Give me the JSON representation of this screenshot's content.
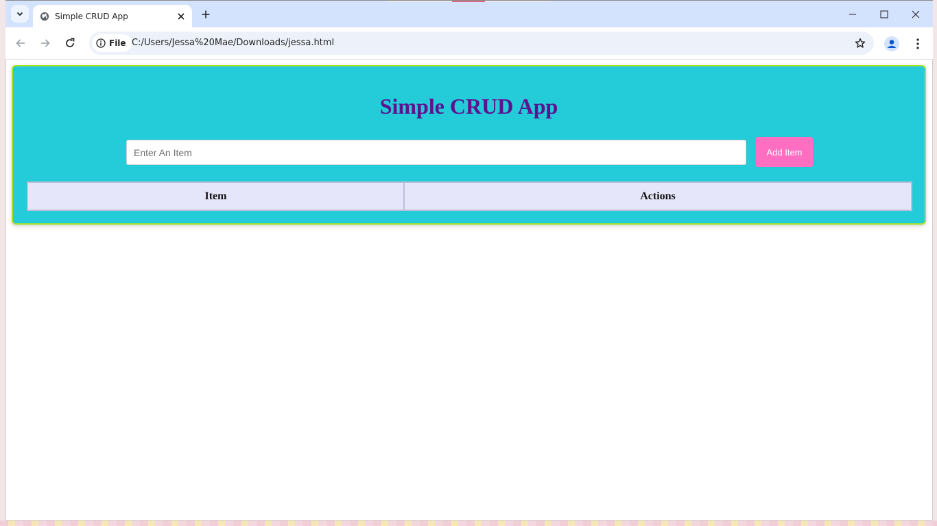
{
  "browser": {
    "tab_title": "Simple CRUD App",
    "chip_label": "File",
    "url": "C:/Users/Jessa%20Mae/Downloads/jessa.html"
  },
  "app": {
    "heading": "Simple CRUD App",
    "input_placeholder": "Enter An Item",
    "input_value": "",
    "add_button_label": "Add Item",
    "table_headers": [
      "Item",
      "Actions"
    ],
    "rows": []
  },
  "colors": {
    "panel_bg": "#24cbd9",
    "panel_border": "#a8e22a",
    "heading": "#5b1390",
    "button": "#ff6ec1",
    "table_header_bg": "#e6e6fa"
  },
  "icons": {
    "tab_search": "chevron-down-icon",
    "favicon": "globe-icon",
    "tab_close": "close-icon",
    "new_tab": "plus-icon",
    "back": "arrow-left-icon",
    "forward": "arrow-right-icon",
    "reload": "reload-icon",
    "site_info": "info-icon",
    "bookmark": "star-icon",
    "profile": "profile-icon",
    "menu": "kebab-menu-icon",
    "minimize": "minimize-icon",
    "maximize": "maximize-icon",
    "close_window": "close-window-icon"
  }
}
